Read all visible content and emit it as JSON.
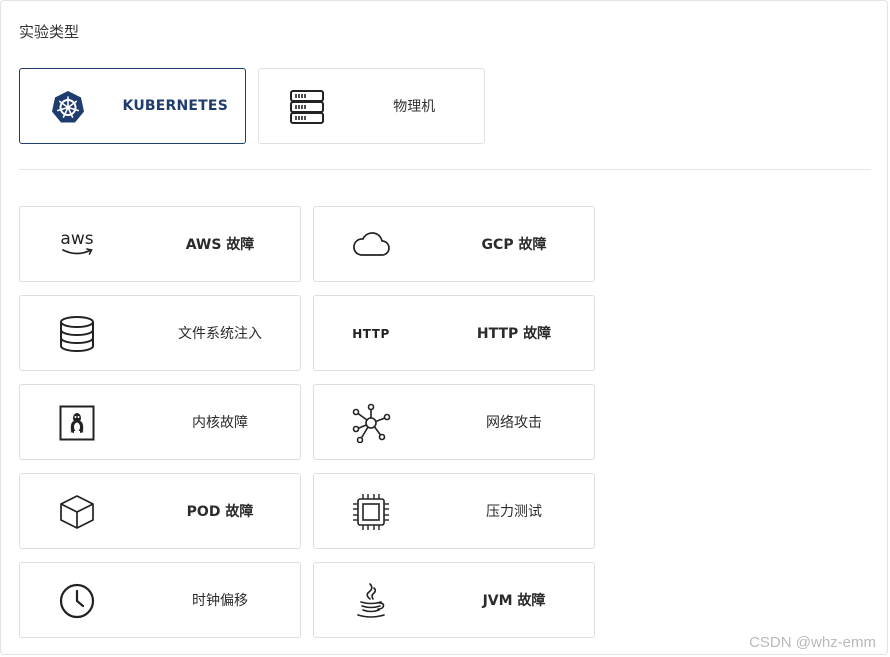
{
  "section_title": "实验类型",
  "target_types": [
    {
      "label": "KUBERNETES",
      "icon": "kubernetes-icon",
      "selected": true
    },
    {
      "label": "物理机",
      "icon": "server-icon",
      "selected": false
    }
  ],
  "faults": [
    {
      "label": "AWS 故障",
      "icon": "aws-icon"
    },
    {
      "label": "GCP 故障",
      "icon": "cloud-icon"
    },
    {
      "label": "文件系统注入",
      "icon": "database-icon"
    },
    {
      "label": "HTTP 故障",
      "icon": "http-icon",
      "icon_text": "HTTP"
    },
    {
      "label": "内核故障",
      "icon": "linux-icon"
    },
    {
      "label": "网络攻击",
      "icon": "network-icon"
    },
    {
      "label": "POD 故障",
      "icon": "cube-icon"
    },
    {
      "label": "压力测试",
      "icon": "cpu-icon"
    },
    {
      "label": "时钟偏移",
      "icon": "clock-icon"
    },
    {
      "label": "JVM 故障",
      "icon": "java-icon"
    }
  ],
  "aws_icon_text": "aws",
  "watermark": "CSDN @whz-emm",
  "colors": {
    "accent": "#1f3c6e",
    "border": "#dedede"
  }
}
